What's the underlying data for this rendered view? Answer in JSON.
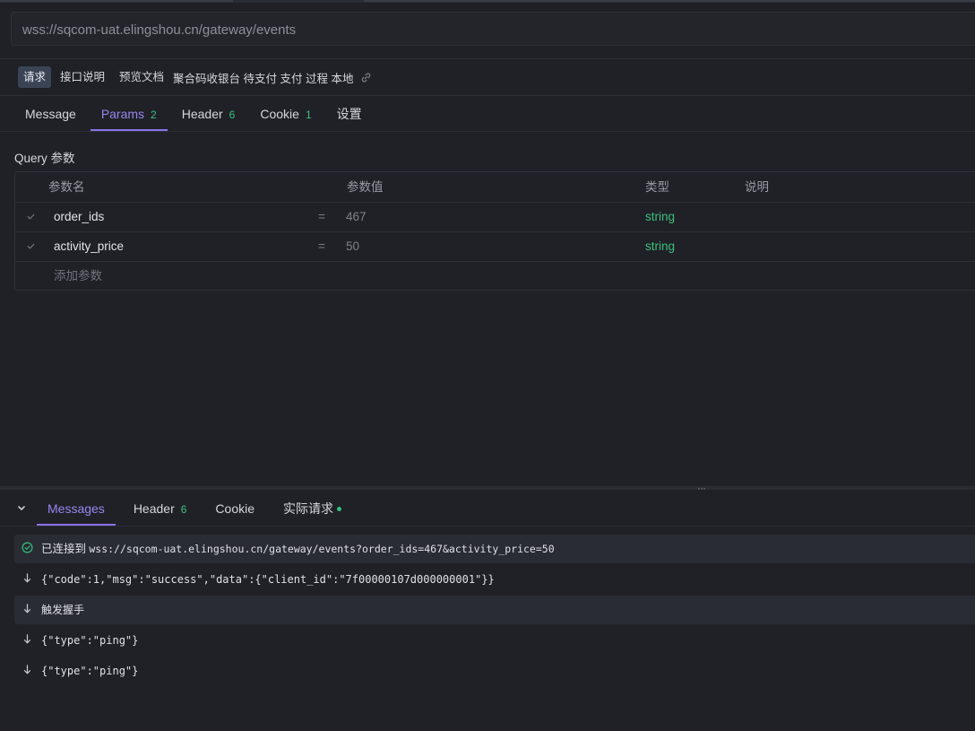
{
  "url": {
    "value": "wss://sqcom-uat.elingshou.cn/gateway/events"
  },
  "doc_tabs": [
    {
      "label": "请求"
    },
    {
      "label": "接口说明"
    },
    {
      "label": "预览文档"
    }
  ],
  "doc_title": "聚合码收银台 待支付 支付 过程 本地",
  "request_tabs": [
    {
      "label": "Message",
      "count": ""
    },
    {
      "label": "Params",
      "count": "2"
    },
    {
      "label": "Header",
      "count": "6"
    },
    {
      "label": "Cookie",
      "count": "1"
    },
    {
      "label": "设置",
      "count": ""
    }
  ],
  "query_section": {
    "title": "Query 参数",
    "columns": [
      "参数名",
      "参数值",
      "类型",
      "说明"
    ],
    "rows": [
      {
        "name": "order_ids",
        "eq": "=",
        "value": "467",
        "type": "string",
        "desc": ""
      },
      {
        "name": "activity_price",
        "eq": "=",
        "value": "50",
        "type": "string",
        "desc": ""
      }
    ],
    "add_placeholder": "添加参数"
  },
  "response_tabs": [
    {
      "label": "Messages",
      "count": ""
    },
    {
      "label": "Header",
      "count": "6"
    },
    {
      "label": "Cookie",
      "count": ""
    },
    {
      "label": "实际请求",
      "count": ""
    }
  ],
  "messages": [
    {
      "kind": "connected",
      "label": "已连接到",
      "text": "wss://sqcom-uat.elingshou.cn/gateway/events?order_ids=467&activity_price=50"
    },
    {
      "kind": "received",
      "text": "{\"code\":1,\"msg\":\"success\",\"data\":{\"client_id\":\"7f00000107d000000001\"}}"
    },
    {
      "kind": "handshake",
      "text": "触发握手"
    },
    {
      "kind": "received",
      "text": "{\"type\":\"ping\"}"
    },
    {
      "kind": "received",
      "text": "{\"type\":\"ping\"}"
    }
  ],
  "colors": {
    "accent": "#8b72e8",
    "type_green": "#3fbf7f",
    "background": "#1f2127"
  },
  "icons": [
    "link-icon",
    "check-icon",
    "chevron-down-icon",
    "check-circle-icon",
    "arrow-down-icon"
  ]
}
